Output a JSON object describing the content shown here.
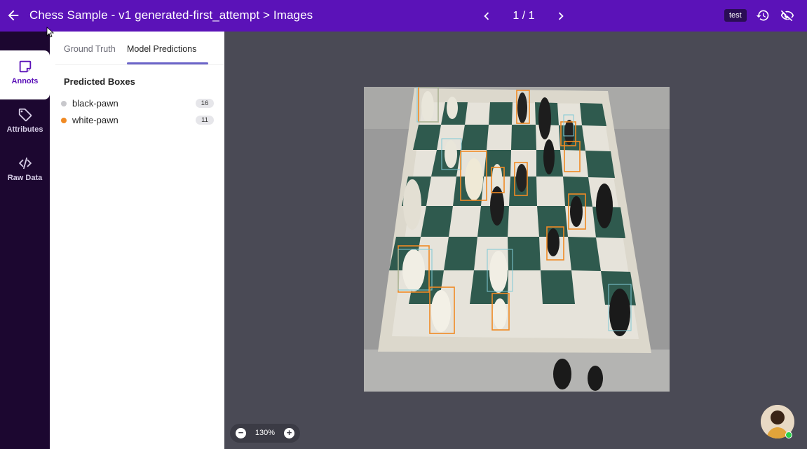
{
  "header": {
    "title": "Chess Sample - v1 generated-first_attempt > Images",
    "page_count": "1 / 1",
    "tag": "test",
    "icons": [
      "arrow-left-icon",
      "chevron-left-icon",
      "chevron-right-icon",
      "history-icon",
      "eye-off-icon"
    ]
  },
  "rail": {
    "items": [
      {
        "label": "Annots",
        "icon": "sticky-note-icon"
      },
      {
        "label": "Attributes",
        "icon": "tag-icon"
      },
      {
        "label": "Raw Data",
        "icon": "code-icon"
      }
    ]
  },
  "panel": {
    "tabs": [
      {
        "label": "Ground Truth"
      },
      {
        "label": "Model Predictions"
      }
    ],
    "section_title": "Predicted Boxes",
    "classes": [
      {
        "name": "black-pawn",
        "count": "16",
        "color": "#c8c8cc"
      },
      {
        "name": "white-pawn",
        "count": "11",
        "color": "#f08a24"
      }
    ]
  },
  "viewer": {
    "zoom": "130%",
    "box_colors": {
      "orange": "#f08a24",
      "teal": "#7fc9d6"
    }
  }
}
